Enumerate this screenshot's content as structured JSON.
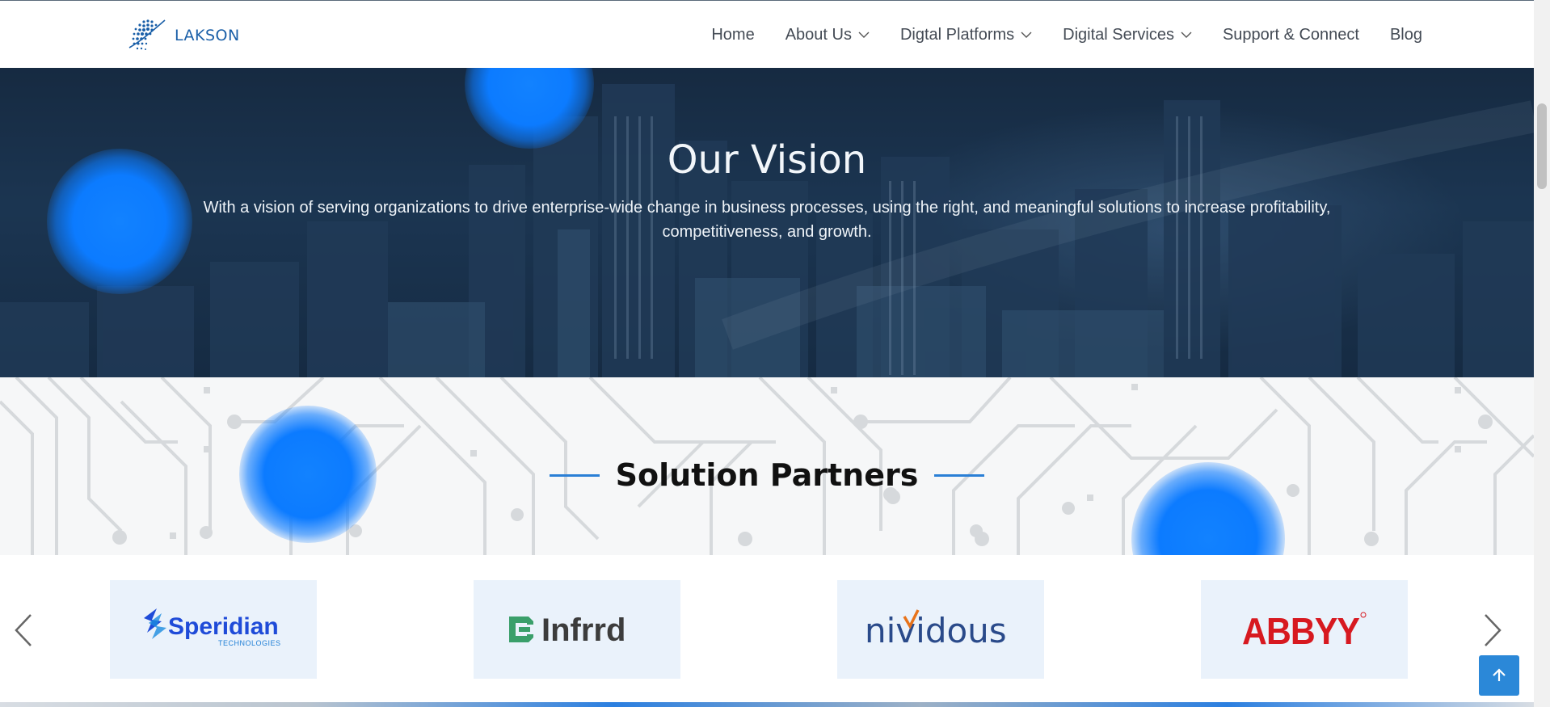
{
  "header": {
    "logo_text": "LAKSON",
    "nav": [
      {
        "label": "Home",
        "has_dropdown": false
      },
      {
        "label": "About Us",
        "has_dropdown": true
      },
      {
        "label": "Digtal Platforms",
        "has_dropdown": true
      },
      {
        "label": "Digital Services",
        "has_dropdown": true
      },
      {
        "label": "Support & Connect",
        "has_dropdown": false
      },
      {
        "label": "Blog",
        "has_dropdown": false
      }
    ]
  },
  "vision": {
    "title": "Our Vision",
    "text": "With a vision of serving organizations to drive enterprise-wide change in business processes, using the right, and meaningful solutions to increase profitability, competitiveness, and growth."
  },
  "partners": {
    "title": "Solution Partners",
    "logos": [
      {
        "name": "Speridian",
        "sub": "TECHNOLOGIES"
      },
      {
        "name": "Infrrd"
      },
      {
        "name": "nividous"
      },
      {
        "name": "ABBYY"
      }
    ]
  },
  "colors": {
    "accent": "#2a7fd6",
    "nav_text": "#444b55",
    "hero_bg": "#1b2f46",
    "blob": "#0c7bff",
    "to_top_bg": "#2b88d8"
  },
  "icons": {
    "prev": "chevron-left-icon",
    "next": "chevron-right-icon",
    "to_top": "arrow-up-icon",
    "dropdown": "chevron-down-icon"
  }
}
